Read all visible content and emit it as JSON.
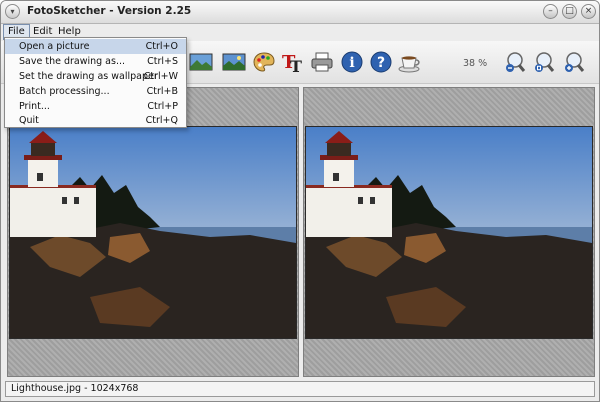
{
  "window": {
    "title": "FotoSketcher - Version 2.25"
  },
  "menubar": {
    "items": [
      "File",
      "Edit",
      "Help"
    ]
  },
  "file_menu": {
    "items": [
      {
        "label": "Open a picture",
        "shortcut": "Ctrl+O"
      },
      {
        "label": "Save the drawing as...",
        "shortcut": "Ctrl+S"
      },
      {
        "label": "Set the drawing as wallpaper",
        "shortcut": "Ctrl+W"
      },
      {
        "label": "Batch processing...",
        "shortcut": "Ctrl+B"
      },
      {
        "label": "Print...",
        "shortcut": "Ctrl+P"
      },
      {
        "label": "Quit",
        "shortcut": "Ctrl+Q"
      }
    ]
  },
  "toolbar": {
    "zoom_level": "38 %",
    "icons": [
      "landscape-icon",
      "landscape-icon",
      "palette-icon",
      "text-tool-icon",
      "printer-icon",
      "info-icon",
      "help-icon",
      "coffee-cup-icon",
      "zoom-out-icon",
      "zoom-reset-icon",
      "zoom-in-icon"
    ]
  },
  "status": {
    "text": "Lighthouse.jpg - 1024x768"
  },
  "colors": {
    "menu_highlight": "#c7d6ea",
    "sky_top": "#4a7fc8",
    "sky_bottom": "#e8b88a"
  }
}
